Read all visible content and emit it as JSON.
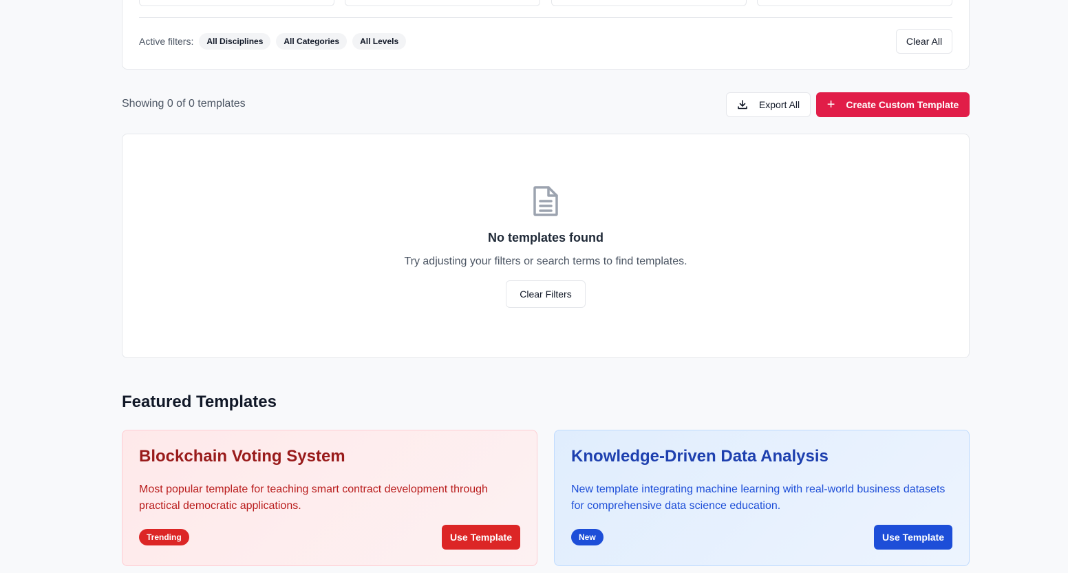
{
  "filters": {
    "active_label": "Active filters:",
    "chips": [
      "All Disciplines",
      "All Categories",
      "All Levels"
    ],
    "clear_all_label": "Clear All"
  },
  "results": {
    "showing_text": "Showing 0 of 0 templates",
    "export_label": "Export All",
    "create_label": "Create Custom Template",
    "create_icon": "plus-icon",
    "export_icon": "download-icon"
  },
  "empty_state": {
    "icon": "document-icon",
    "title": "No templates found",
    "subtitle": "Try adjusting your filters or search terms to find templates.",
    "clear_filters_label": "Clear Filters"
  },
  "featured": {
    "title": "Featured Templates",
    "cards": [
      {
        "title": "Blockchain Voting System",
        "description": "Most popular template for teaching smart contract development through practical democratic applications.",
        "badge": "Trending",
        "button": "Use Template",
        "accent": "#dc2626"
      },
      {
        "title": "Knowledge-Driven Data Analysis",
        "description": "New template integrating machine learning with real-world business datasets for comprehensive data science education.",
        "badge": "New",
        "button": "Use Template",
        "accent": "#1d4ed8"
      }
    ]
  },
  "colors": {
    "primary": "#e11d48",
    "background": "#f8f9fb"
  }
}
